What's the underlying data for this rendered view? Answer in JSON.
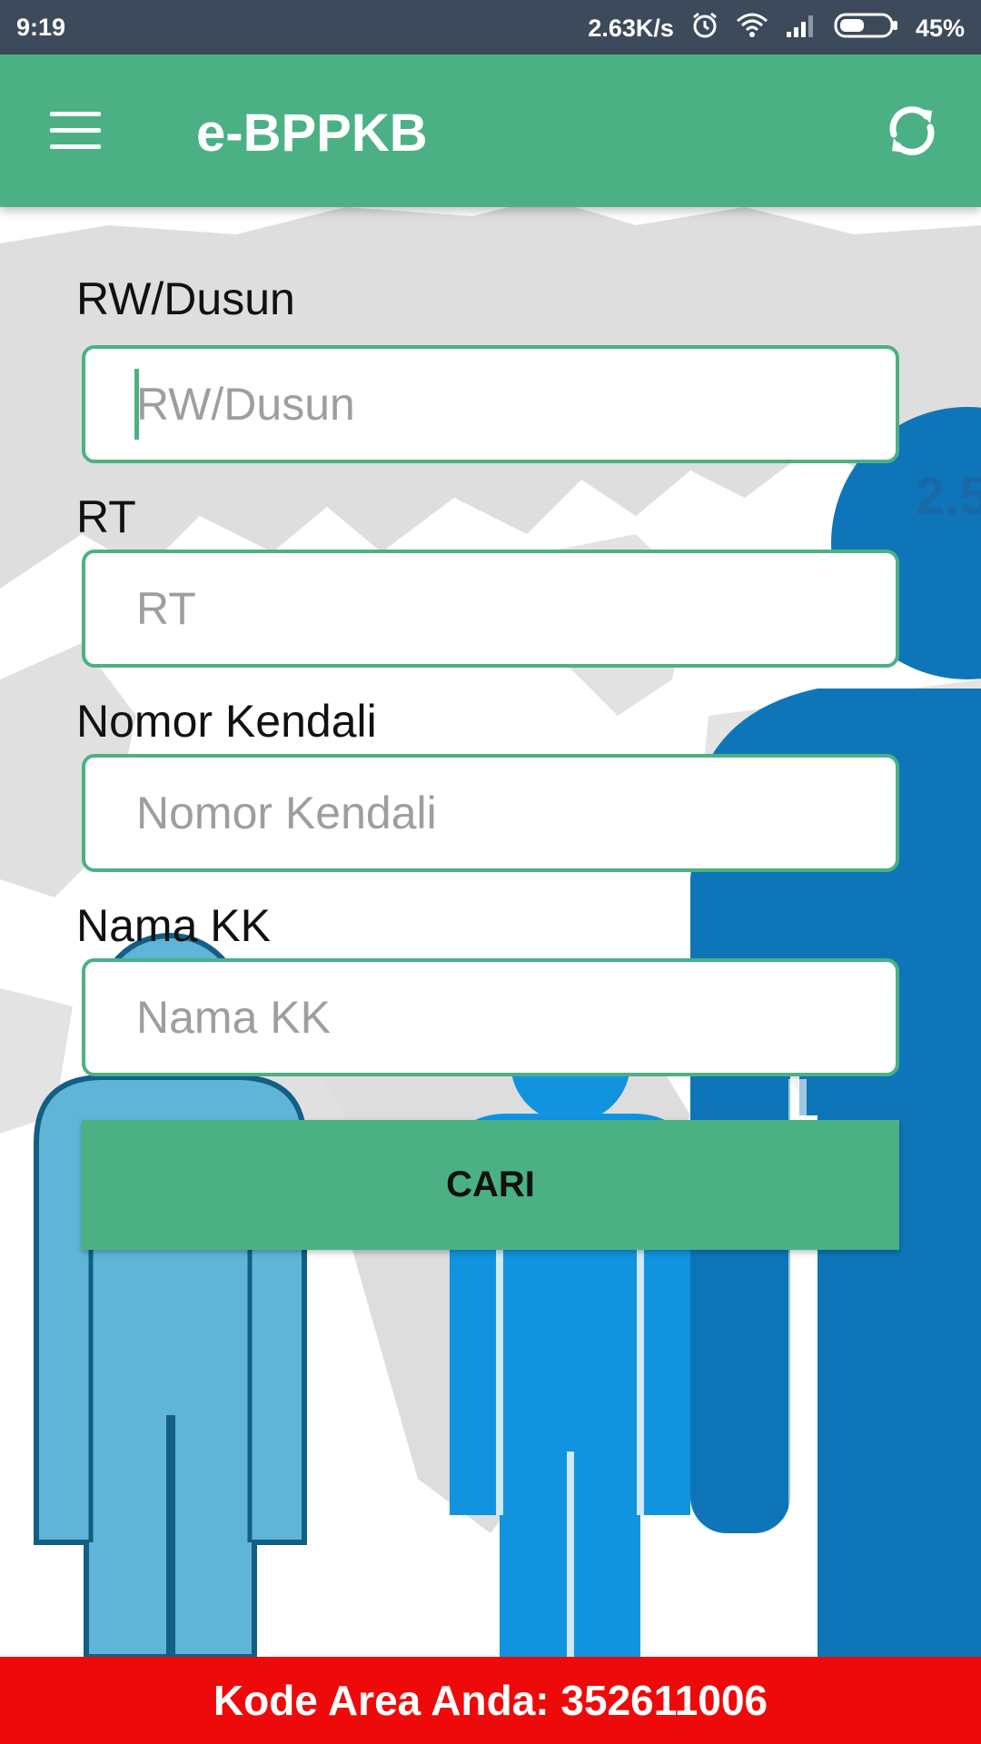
{
  "status_bar": {
    "time": "9:19",
    "net_speed": "2.63K/s",
    "battery": "45%",
    "icons": [
      "alarm-icon",
      "wifi-icon",
      "signal-icon",
      "battery-icon"
    ]
  },
  "app_bar": {
    "title": "e-BPPKB",
    "menu_icon": "hamburger-menu-icon",
    "refresh_icon": "refresh-icon",
    "color": "#4bb184"
  },
  "background": {
    "stat_text": "2.5"
  },
  "form": {
    "rw": {
      "label": "RW/Dusun",
      "placeholder": "RW/Dusun",
      "value": ""
    },
    "rt": {
      "label": "RT",
      "placeholder": "RT",
      "value": ""
    },
    "nomor": {
      "label": "Nomor Kendali",
      "placeholder": "Nomor Kendali",
      "value": ""
    },
    "nama": {
      "label": "Nama KK",
      "placeholder": "Nama KK",
      "value": ""
    },
    "submit_label": "CARI"
  },
  "footer": {
    "text": "Kode Area Anda: 352611006",
    "color": "#ee0a0a"
  }
}
